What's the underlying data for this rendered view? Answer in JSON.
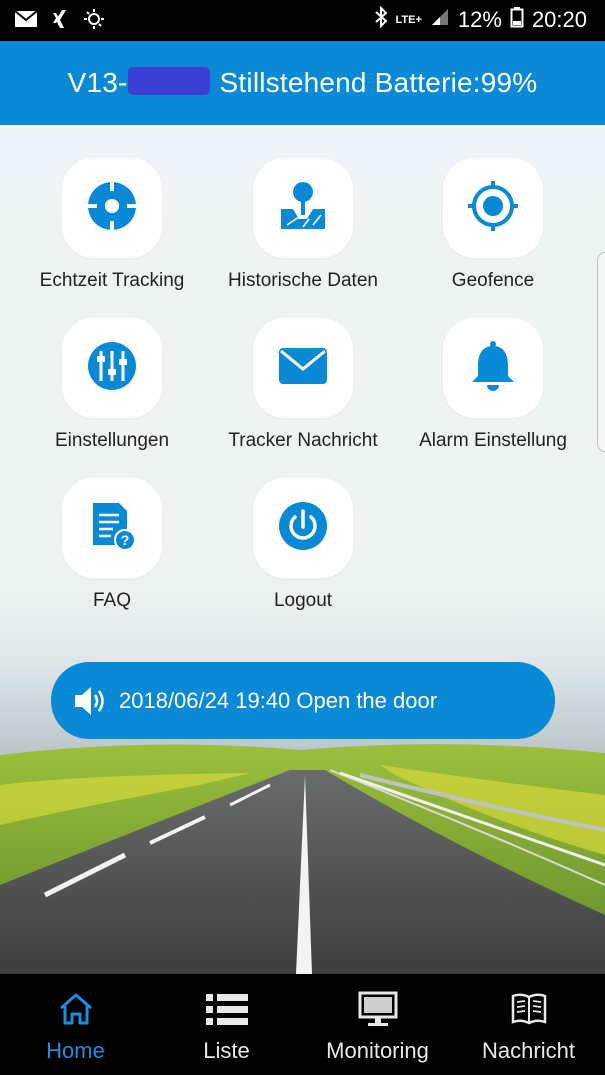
{
  "status_bar": {
    "battery_percent": "12%",
    "time": "20:20",
    "network": "LTE+",
    "icons": [
      "mail-icon",
      "xing-icon",
      "sun-icon",
      "bluetooth-icon",
      "signal-icon",
      "battery-icon"
    ]
  },
  "header": {
    "prefix": "V13-",
    "status_text": "Stillstehend Batterie:99%"
  },
  "menu": {
    "items": [
      {
        "label": "Echtzeit Tracking",
        "icon": "target-icon"
      },
      {
        "label": "Historische Daten",
        "icon": "map-pin-icon"
      },
      {
        "label": "Geofence",
        "icon": "crosshair-icon"
      },
      {
        "label": "Einstellungen",
        "icon": "sliders-icon"
      },
      {
        "label": "Tracker Nachricht",
        "icon": "envelope-icon"
      },
      {
        "label": "Alarm Einstellung",
        "icon": "bell-icon"
      },
      {
        "label": "FAQ",
        "icon": "faq-document-icon"
      },
      {
        "label": "Logout",
        "icon": "power-icon"
      }
    ]
  },
  "notice": {
    "text": "2018/06/24 19:40 Open the door",
    "icon": "speaker-icon"
  },
  "bottom_nav": {
    "items": [
      {
        "label": "Home",
        "icon": "home-icon",
        "active": true
      },
      {
        "label": "Liste",
        "icon": "list-icon",
        "active": false
      },
      {
        "label": "Monitoring",
        "icon": "monitor-icon",
        "active": false
      },
      {
        "label": "Nachricht",
        "icon": "book-icon",
        "active": false
      }
    ]
  },
  "colors": {
    "accent": "#0a8ad6",
    "active_nav": "#1a8ee0"
  }
}
